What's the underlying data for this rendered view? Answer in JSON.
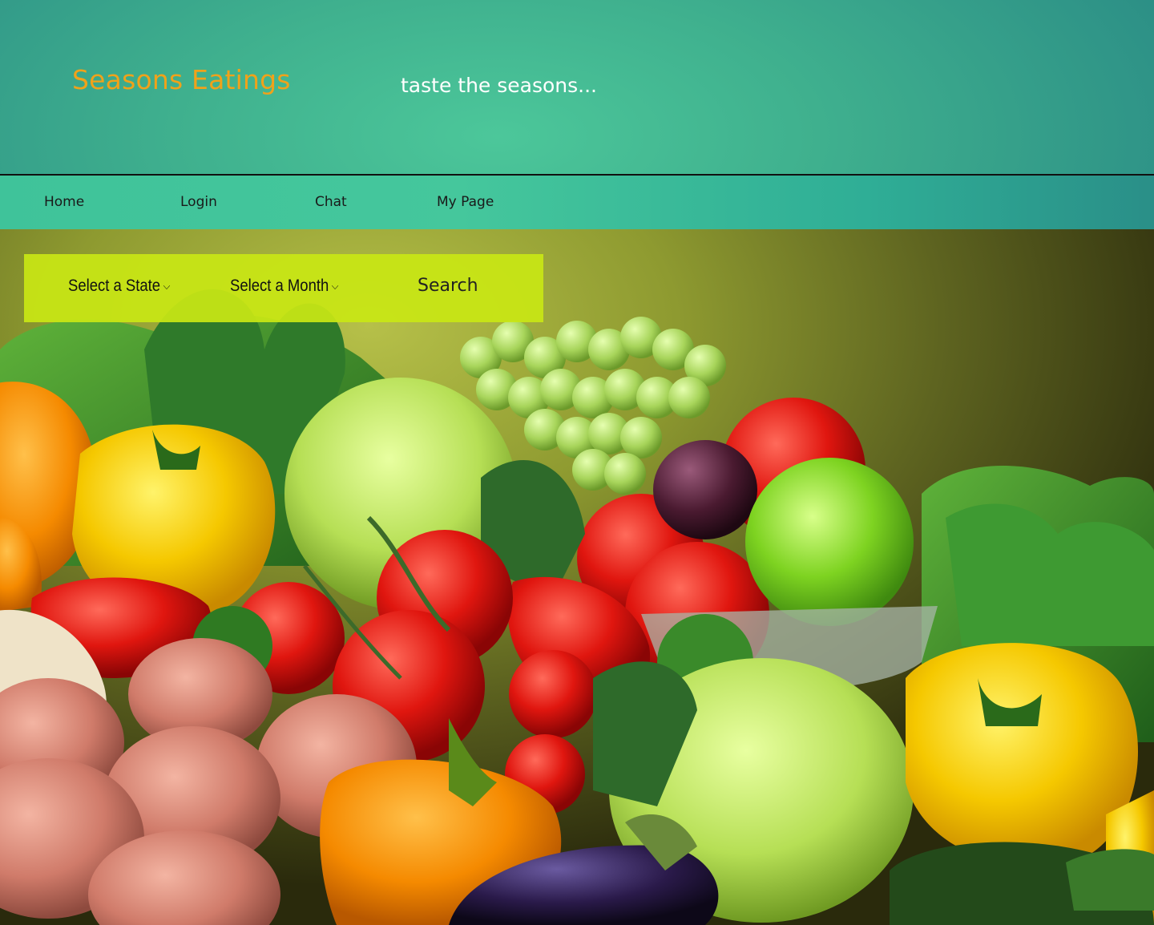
{
  "header": {
    "logo": "Seasons Eatings",
    "tagline": "taste the seasons..."
  },
  "nav": {
    "items": [
      {
        "label": "Home"
      },
      {
        "label": "Login"
      },
      {
        "label": "Chat"
      },
      {
        "label": "My Page"
      }
    ]
  },
  "search": {
    "state_select": "Select a State",
    "month_select": "Select a Month",
    "search_button": "Search"
  },
  "hero": {
    "image": "fresh-produce-background"
  },
  "colors": {
    "brand_orange": "#f0a21a",
    "header_teal": "#3fb08e",
    "search_bar_lime": "#c8e614"
  }
}
